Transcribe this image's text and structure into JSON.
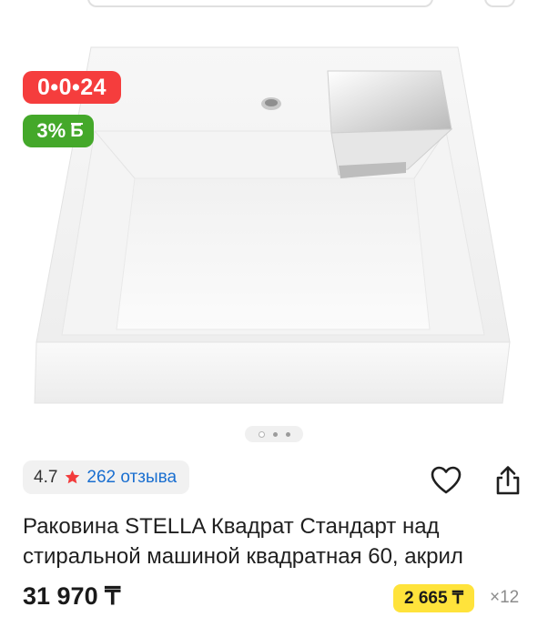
{
  "gallery": {
    "badges": {
      "timer": "0•0•24",
      "cashback_percent": "3%",
      "cashback_currency": "Б"
    },
    "image_icon": "wall-mounted-square-sink-image",
    "pager": {
      "count": 3,
      "active_index": 0
    }
  },
  "rating": {
    "value": "4.7",
    "star_icon": "star-icon",
    "reviews_label": "262 отзыва"
  },
  "actions": {
    "favorite_icon": "heart-icon",
    "share_icon": "share-icon"
  },
  "product": {
    "title_line1": "Раковина STELLA Квадрат Стандарт над",
    "title_line2": "стиральной машиной квадратная 60, акрил",
    "price": "31 970 ₸",
    "installment_amount": "2 665 ₸",
    "installment_months": "×12"
  },
  "colors": {
    "timer_badge": "#f53d3d",
    "cashback_badge": "#44a82a",
    "installment_badge": "#ffe33b",
    "link": "#1a6fd0",
    "star": "#f23b3b"
  }
}
